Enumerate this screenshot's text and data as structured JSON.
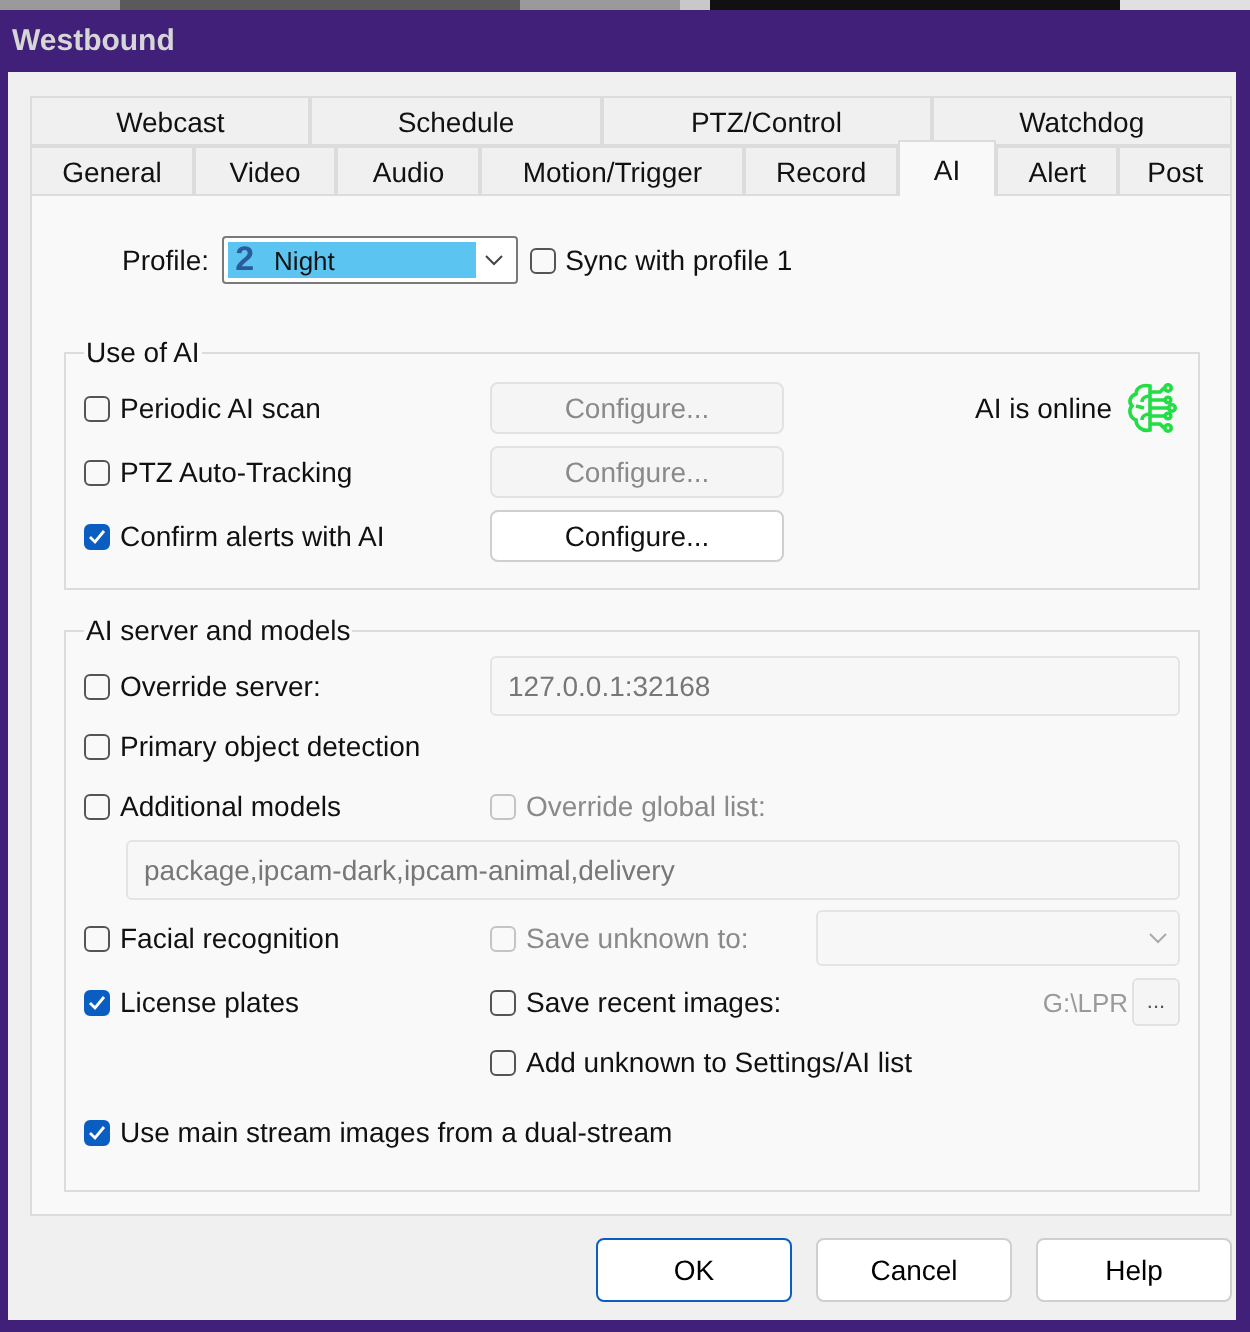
{
  "window": {
    "title": "Westbound"
  },
  "tabs": [
    [
      {
        "label": "Webcast",
        "selected": false
      },
      {
        "label": "Schedule",
        "selected": false
      },
      {
        "label": "PTZ/Control",
        "selected": false
      },
      {
        "label": "Watchdog",
        "selected": false
      }
    ],
    [
      {
        "label": "General",
        "selected": false
      },
      {
        "label": "Video",
        "selected": false
      },
      {
        "label": "Audio",
        "selected": false
      },
      {
        "label": "Motion/Trigger",
        "selected": false
      },
      {
        "label": "Record",
        "selected": false
      },
      {
        "label": "AI",
        "selected": true
      },
      {
        "label": "Alert",
        "selected": false
      },
      {
        "label": "Post",
        "selected": false
      }
    ]
  ],
  "profile": {
    "label": "Profile:",
    "number": "2",
    "value": "Night",
    "sync": {
      "label": "Sync with profile 1",
      "checked": false
    }
  },
  "use_of_ai": {
    "title": "Use of AI",
    "status": "AI is online",
    "items": [
      {
        "label": "Periodic AI scan",
        "checked": false,
        "button": {
          "label": "Configure...",
          "disabled": true
        }
      },
      {
        "label": "PTZ Auto-Tracking",
        "checked": false,
        "button": {
          "label": "Configure...",
          "disabled": true
        }
      },
      {
        "label": "Confirm alerts with AI",
        "checked": true,
        "button": {
          "label": "Configure...",
          "disabled": false
        }
      }
    ]
  },
  "ai_server": {
    "title": "AI server and models",
    "override_server": {
      "label": "Override server:",
      "checked": false,
      "value": "127.0.0.1:32168"
    },
    "primary_detection": {
      "label": "Primary object detection",
      "checked": false
    },
    "additional_models": {
      "label": "Additional models",
      "checked": false,
      "override": {
        "label": "Override global list:",
        "checked": false,
        "disabled": true
      },
      "value": "package,ipcam-dark,ipcam-animal,delivery"
    },
    "facial_recognition": {
      "label": "Facial recognition",
      "checked": false,
      "save_unknown": {
        "label": "Save unknown to:",
        "checked": false,
        "disabled": true
      }
    },
    "license_plates": {
      "label": "License plates",
      "checked": true,
      "save_recent": {
        "label": "Save recent images:",
        "checked": false,
        "path": "G:\\LPR",
        "browse": "..."
      },
      "add_unknown": {
        "label": "Add unknown to Settings/AI list",
        "checked": false
      }
    },
    "main_stream": {
      "label": "Use main stream images from a dual-stream",
      "checked": true
    }
  },
  "buttons": [
    {
      "label": "OK",
      "default": true
    },
    {
      "label": "Cancel",
      "default": false
    },
    {
      "label": "Help",
      "default": false
    }
  ]
}
